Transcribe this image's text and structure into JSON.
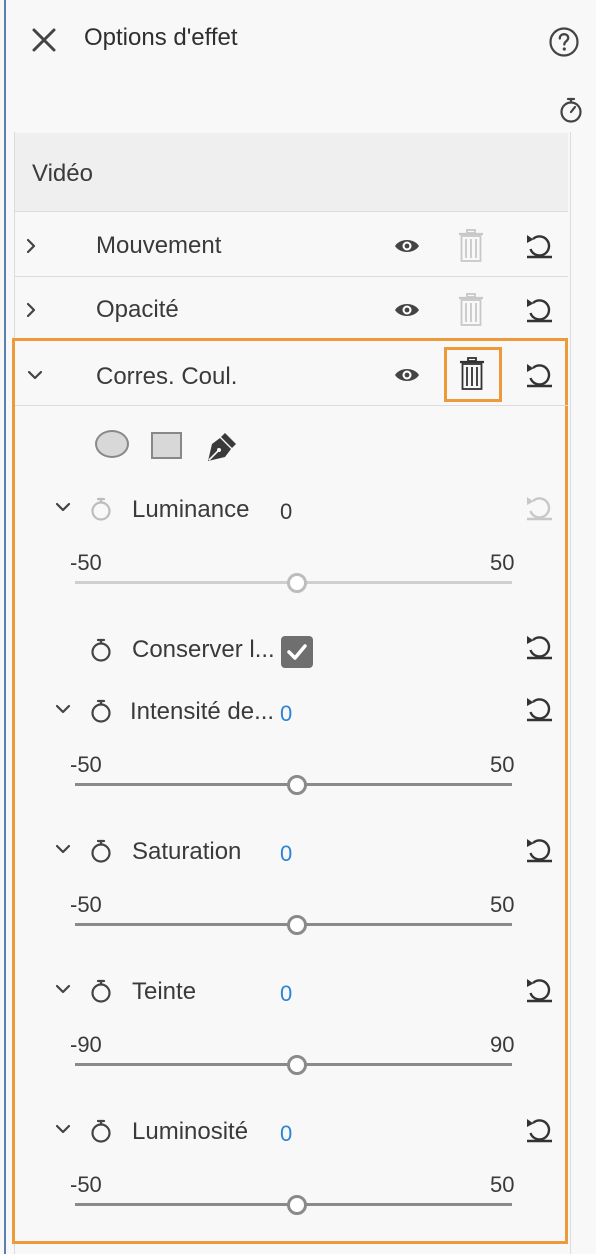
{
  "header": {
    "title": "Options d'effet",
    "close_icon": "close-icon",
    "help_icon": "help-icon",
    "stopwatch_icon": "stopwatch-icon"
  },
  "section": {
    "label": "Vidéo"
  },
  "effects": [
    {
      "label": "Mouvement",
      "expanded": false
    },
    {
      "label": "Opacité",
      "expanded": false
    },
    {
      "label": "Corres. Coul.",
      "expanded": true
    }
  ],
  "mask_tools": [
    "ellipse-mask-icon",
    "rectangle-mask-icon",
    "pen-mask-icon"
  ],
  "params": {
    "luminance": {
      "label": "Luminance",
      "value": "0",
      "min": "-50",
      "max": "50",
      "position": 0.5
    },
    "conserver": {
      "label": "Conserver l...",
      "checked": true
    },
    "intensite": {
      "label": "Intensité de...",
      "value": "0",
      "min": "-50",
      "max": "50",
      "position": 0.5
    },
    "saturation": {
      "label": "Saturation",
      "value": "0",
      "min": "-50",
      "max": "50",
      "position": 0.5
    },
    "teinte": {
      "label": "Teinte",
      "value": "0",
      "min": "-90",
      "max": "90",
      "position": 0.5
    },
    "luminosite": {
      "label": "Luminosité",
      "value": "0",
      "min": "-50",
      "max": "50",
      "position": 0.5
    }
  },
  "colors": {
    "highlight": "#ec9a3a",
    "value_blue": "#2a84d8",
    "panel_bg": "#f8f8f8"
  }
}
